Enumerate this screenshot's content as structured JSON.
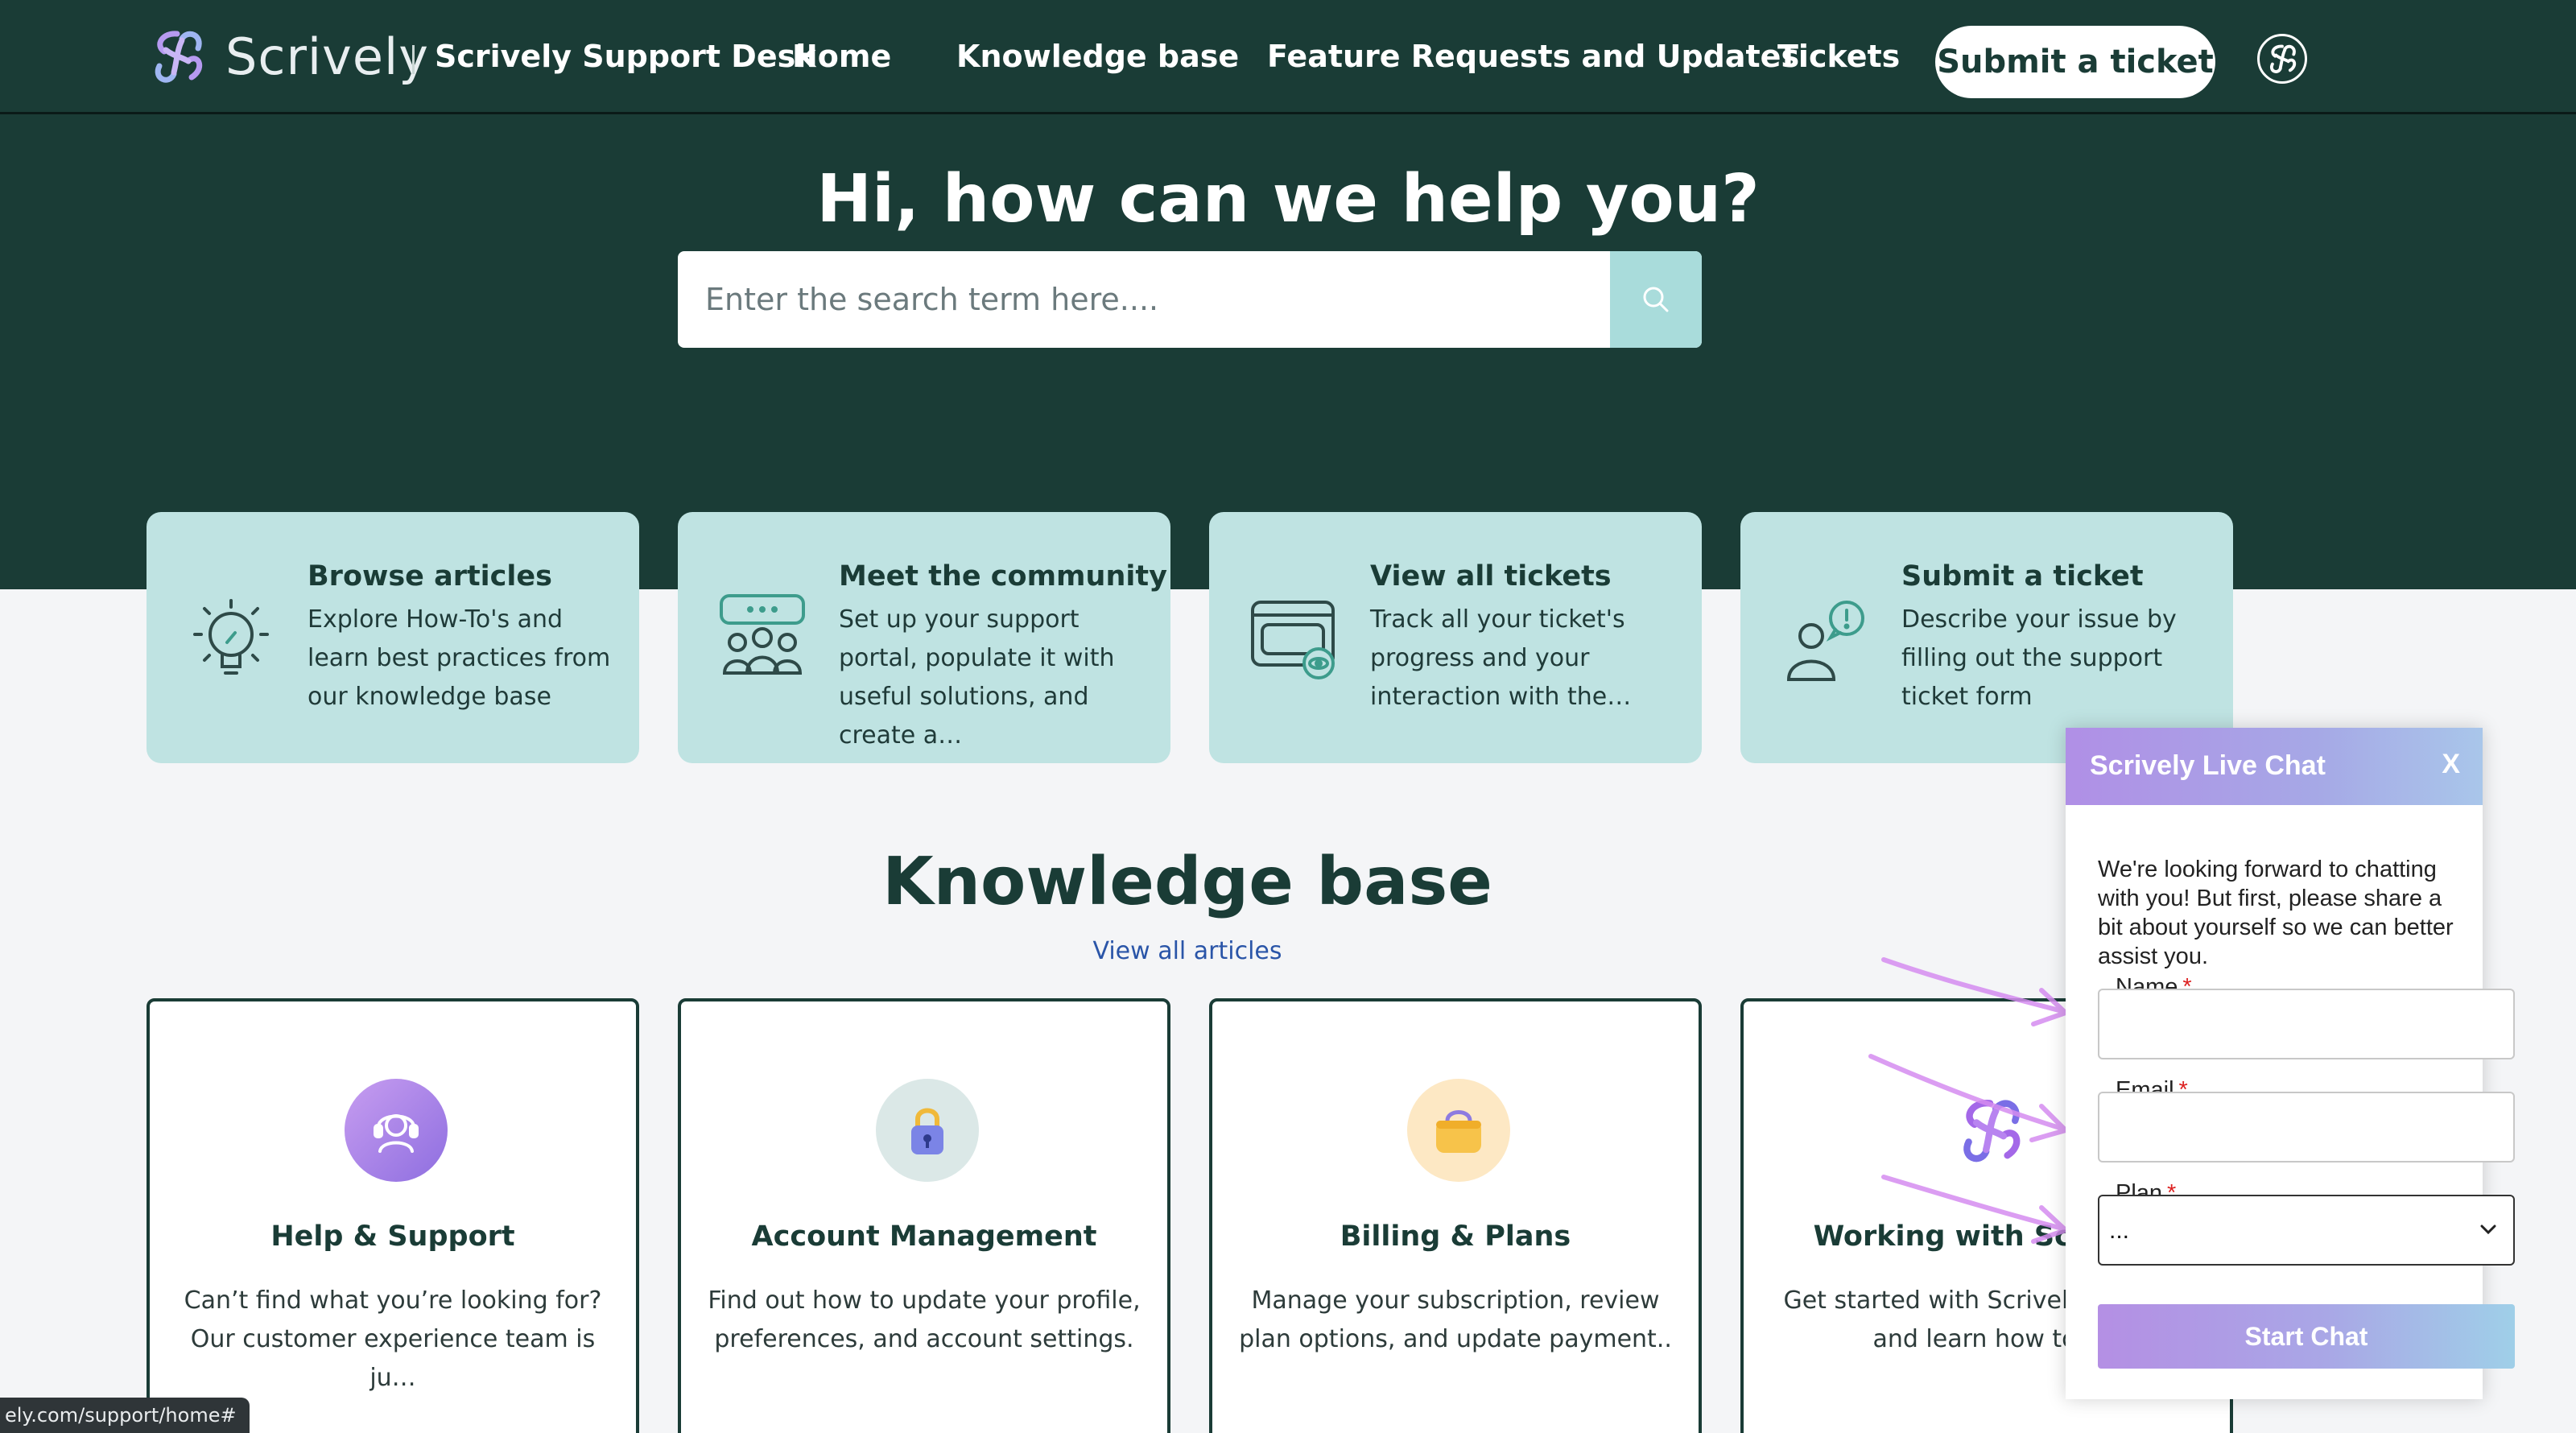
{
  "header": {
    "brand": "Scrively",
    "desk_title": "Scrively Support Desk",
    "nav": [
      "Home",
      "Knowledge base",
      "Feature Requests and Updates",
      "Tickets"
    ],
    "submit_label": "Submit a ticket",
    "colors": {
      "header_bg": "#1a3c36",
      "card_bg": "#bfe3e2"
    }
  },
  "hero": {
    "title": "Hi, how can we help you?",
    "search_placeholder": "Enter the search term here...."
  },
  "quick_cards": [
    {
      "icon": "lightbulb-icon",
      "title": "Browse articles",
      "desc": "Explore How-To's and learn best practices from our knowledge base"
    },
    {
      "icon": "community-icon",
      "title": "Meet the community",
      "desc": "Set up your support portal, populate it with useful solutions, and create a…"
    },
    {
      "icon": "tickets-icon",
      "title": "View all tickets",
      "desc": "Track all your ticket's progress and your interaction with the…"
    },
    {
      "icon": "person-alert-icon",
      "title": "Submit a ticket",
      "desc": "Describe your issue by filling out the support ticket form"
    }
  ],
  "knowledge_base": {
    "title": "Knowledge base",
    "view_all": "View all articles",
    "cards": [
      {
        "icon": "headset-icon",
        "title": "Help & Support",
        "desc": "Can’t find what you’re looking for? Our customer experience team is ju…"
      },
      {
        "icon": "lock-icon",
        "title": "Account Management",
        "desc": "Find out how to update your profile, preferences, and account settings."
      },
      {
        "icon": "wallet-icon",
        "title": "Billing & Plans",
        "desc": "Manage your subscription, review plan options, and update payment.."
      },
      {
        "icon": "scrively-logo-icon",
        "title": "Working with Scrively",
        "desc": "Get started with Scrively features and learn how to…"
      }
    ]
  },
  "status_bar": {
    "url": "ely.com/support/home#"
  },
  "live_chat": {
    "title": "Scrively Live Chat",
    "close": "X",
    "intro": "We're looking forward to chatting with you! But first, please share a bit about yourself so we can better assist you.",
    "fields": [
      {
        "label": "Name",
        "required": "*",
        "value": ""
      },
      {
        "label": "Email",
        "required": "*",
        "value": ""
      },
      {
        "label": "Plan",
        "required": "*",
        "value": "..."
      }
    ],
    "start_label": "Start Chat"
  }
}
